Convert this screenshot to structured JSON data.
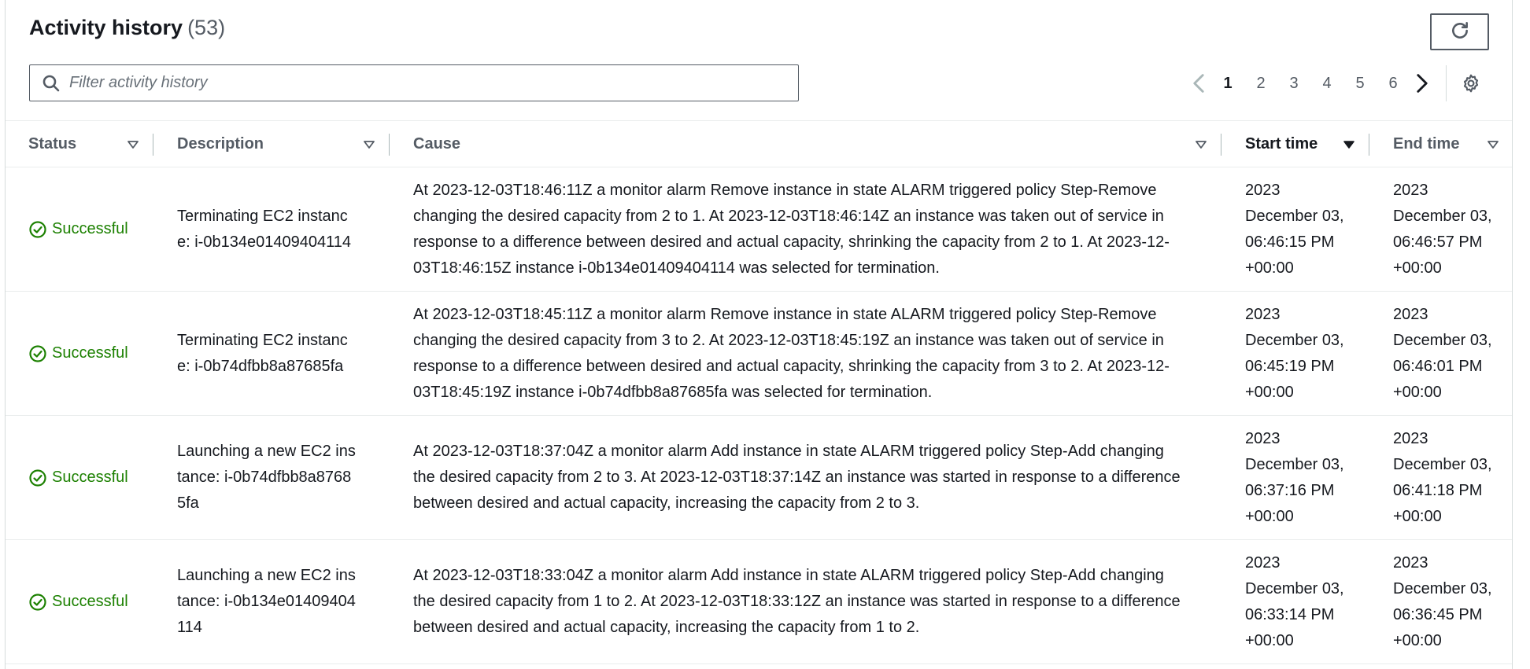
{
  "header": {
    "title": "Activity history",
    "count": "(53)",
    "refresh_icon": "refresh-icon"
  },
  "search": {
    "placeholder": "Filter activity history",
    "value": "",
    "icon": "search-icon"
  },
  "pagination": {
    "prev_icon": "chevron-left-icon",
    "next_icon": "chevron-right-icon",
    "pages": [
      "1",
      "2",
      "3",
      "4",
      "5",
      "6"
    ],
    "current_page": "1",
    "settings_icon": "gear-icon"
  },
  "table": {
    "columns": {
      "status": "Status",
      "description": "Description",
      "cause": "Cause",
      "start_time": "Start time",
      "end_time": "End time"
    },
    "sorted_column": "start_time",
    "rows": [
      {
        "status": "Successful",
        "description": "Terminating EC2 instance: i-0b134e01409404114",
        "cause": "At 2023-12-03T18:46:11Z a monitor alarm Remove instance in state ALARM triggered policy Step-Remove changing the desired capacity from 2 to 1. At 2023-12-03T18:46:14Z an instance was taken out of service in response to a difference between desired and actual capacity, shrinking the capacity from 2 to 1. At 2023-12-03T18:46:15Z instance i-0b134e01409404114 was selected for termination.",
        "start_time": "2023 December 03, 06:46:15 PM +00:00",
        "end_time": "2023 December 03, 06:46:57 PM +00:00"
      },
      {
        "status": "Successful",
        "description": "Terminating EC2 instance: i-0b74dfbb8a87685fa",
        "cause": "At 2023-12-03T18:45:11Z a monitor alarm Remove instance in state ALARM triggered policy Step-Remove changing the desired capacity from 3 to 2. At 2023-12-03T18:45:19Z an instance was taken out of service in response to a difference between desired and actual capacity, shrinking the capacity from 3 to 2. At 2023-12-03T18:45:19Z instance i-0b74dfbb8a87685fa was selected for termination.",
        "start_time": "2023 December 03, 06:45:19 PM +00:00",
        "end_time": "2023 December 03, 06:46:01 PM +00:00"
      },
      {
        "status": "Successful",
        "description": "Launching a new EC2 instance: i-0b74dfbb8a87685fa",
        "cause": "At 2023-12-03T18:37:04Z a monitor alarm Add instance in state ALARM triggered policy Step-Add changing the desired capacity from 2 to 3. At 2023-12-03T18:37:14Z an instance was started in response to a difference between desired and actual capacity, increasing the capacity from 2 to 3.",
        "start_time": "2023 December 03, 06:37:16 PM +00:00",
        "end_time": "2023 December 03, 06:41:18 PM +00:00"
      },
      {
        "status": "Successful",
        "description": "Launching a new EC2 instance: i-0b134e01409404114",
        "cause": "At 2023-12-03T18:33:04Z a monitor alarm Add instance in state ALARM triggered policy Step-Add changing the desired capacity from 1 to 2. At 2023-12-03T18:33:12Z an instance was started in response to a difference between desired and actual capacity, increasing the capacity from 1 to 2.",
        "start_time": "2023 December 03, 06:33:14 PM +00:00",
        "end_time": "2023 December 03, 06:36:45 PM +00:00"
      }
    ]
  },
  "colors": {
    "success": "#1d8102",
    "text": "#16191f",
    "muted": "#545b64",
    "border": "#eaeded"
  }
}
